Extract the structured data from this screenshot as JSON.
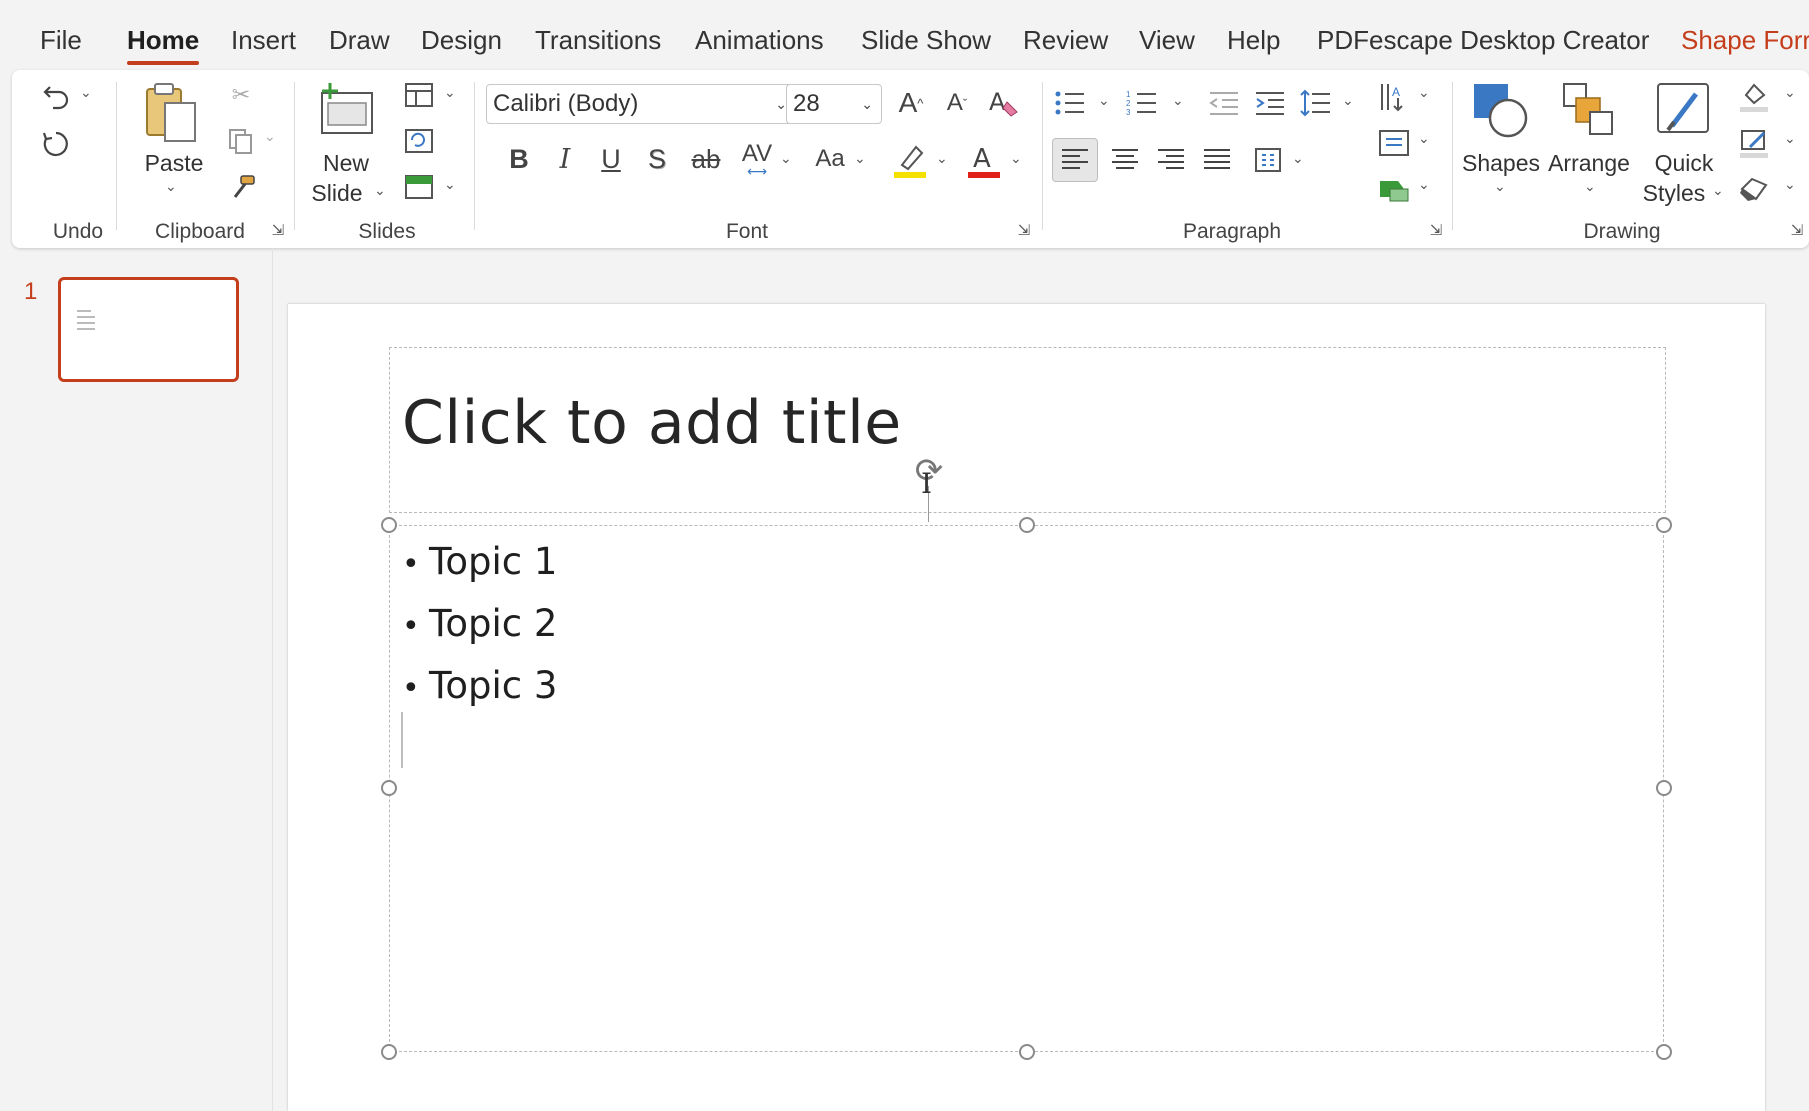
{
  "menu": {
    "tabs": [
      "File",
      "Home",
      "Insert",
      "Draw",
      "Design",
      "Transitions",
      "Animations",
      "Slide Show",
      "Review",
      "View",
      "Help",
      "PDFescape Desktop Creator",
      "Shape Forr"
    ],
    "active": "Home",
    "contextual": "Shape Forr"
  },
  "ribbon": {
    "groups": {
      "undo": "Undo",
      "clipboard": "Clipboard",
      "slides": "Slides",
      "font": "Font",
      "paragraph": "Paragraph",
      "drawing": "Drawing"
    },
    "paste_label": "Paste",
    "new_slide_label_1": "New",
    "new_slide_label_2": "Slide",
    "font_name": "Calibri (Body)",
    "font_size": "28",
    "bold": "B",
    "italic": "I",
    "underline": "U",
    "shadow": "S",
    "strike": "ab",
    "spacing": "AV",
    "change_case": "Aa",
    "shapes_label": "Shapes",
    "arrange_label": "Arrange",
    "quick_styles_label_1": "Quick",
    "quick_styles_label_2": "Styles",
    "highlight_color": "#f5e100",
    "font_color": "#e0221b"
  },
  "thumbnails": {
    "slide_number": "1"
  },
  "slide": {
    "title_placeholder": "Click to add title",
    "bullets": [
      "Topic 1",
      "Topic 2",
      "Topic 3"
    ]
  },
  "colors": {
    "accent": "#c43e1c",
    "ribbon_bg": "#ffffff",
    "app_bg": "#f3f3f3"
  }
}
